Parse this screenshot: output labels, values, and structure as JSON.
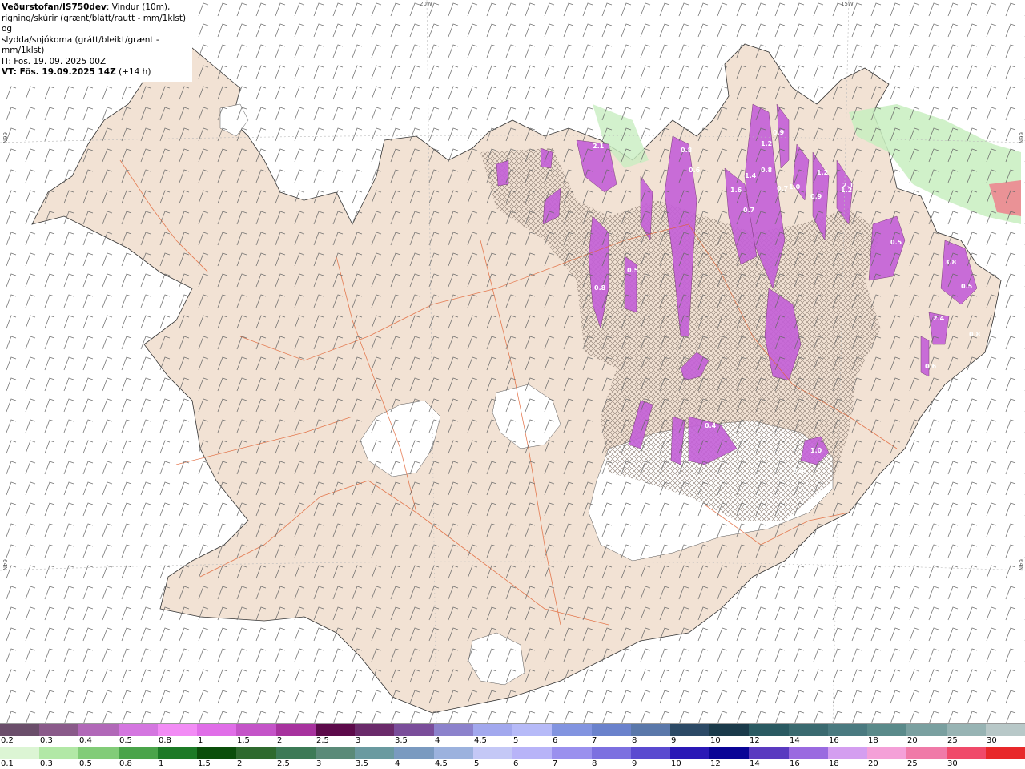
{
  "header": {
    "title_bold": "Veðurstofan/IS750dev",
    "title_rest": ": Vindur (10m),",
    "line2": "rigning/skúrir (grænt/blátt/rautt - mm/1klst) og",
    "line3": "slydda/snjókoma (grátt/bleikt/grænt - mm/1klst)",
    "it_line": "IT: Fös. 19. 09. 2025 00Z",
    "vt_bold": "VT: Fös. 19.09.2025 14Z",
    "vt_rest": " (+14 h)"
  },
  "grid_labels": {
    "lon_20w": "20W",
    "lon_15w": "15W",
    "lat_66n_left": "66N",
    "lat_66n_right": "66N",
    "lat_64n_left": "64N",
    "lat_64n_right": "64N"
  },
  "snow_legend": {
    "labels": [
      "0.2",
      "0.3",
      "0.4",
      "0.5",
      "0.8",
      "1",
      "1.5",
      "2",
      "2.5",
      "3",
      "3.5",
      "4",
      "4.5",
      "5",
      "6",
      "7",
      "8",
      "9",
      "10",
      "12",
      "14",
      "16",
      "18",
      "20",
      "25",
      "30"
    ],
    "colors": [
      "#6b4e6b",
      "#8a5a8a",
      "#b168b8",
      "#d476e0",
      "#f28cf5",
      "#e06ee8",
      "#c454c8",
      "#a7329e",
      "#5c0a4a",
      "#6a2a6a",
      "#7a4d9a",
      "#8c82cc",
      "#a2a8ee",
      "#b6baf8",
      "#8294e0",
      "#6a82cc",
      "#5a78aa",
      "#2c4a66",
      "#1a3a4a",
      "#2a5a62",
      "#3a6a70",
      "#4a7a80",
      "#5a8a8a",
      "#7aa0a0",
      "#98b4b4",
      "#b8c8c8"
    ]
  },
  "rain_legend": {
    "labels": [
      "0.1",
      "0.3",
      "0.5",
      "0.8",
      "1",
      "1.5",
      "2",
      "2.5",
      "3",
      "3.5",
      "4",
      "4.5",
      "5",
      "6",
      "7",
      "8",
      "9",
      "10",
      "12",
      "14",
      "16",
      "18",
      "20",
      "25",
      "30"
    ],
    "colors": [
      "#dcf5d4",
      "#b2e8a6",
      "#82cc78",
      "#4aa44a",
      "#1c7a26",
      "#0a4e0a",
      "#2e6a2e",
      "#3c7a56",
      "#5a8a78",
      "#6a9aa0",
      "#7a9ac0",
      "#9cb2de",
      "#c4c8f6",
      "#b8b4f8",
      "#9a90ee",
      "#7c70e0",
      "#5a4ad0",
      "#2a18b6",
      "#0a0496",
      "#5a3ac0",
      "#9a6ae0",
      "#d49ef0",
      "#f4a0d8",
      "#f07aa8",
      "#f04a6a",
      "#e8282a"
    ]
  },
  "precip_labels": [
    "2.1",
    "1.2",
    "0.9",
    "1.2",
    "1.6",
    "1.4",
    "0.8",
    "0.7",
    "1.0",
    "0.7",
    "0.5",
    "0.9",
    "1.2",
    "2.1",
    "0.8",
    "0.8",
    "0.5",
    "2.4",
    "3.8",
    "0.6",
    "0.5",
    "0.8",
    "0.6",
    "0.4",
    "0.3",
    "1.0"
  ]
}
